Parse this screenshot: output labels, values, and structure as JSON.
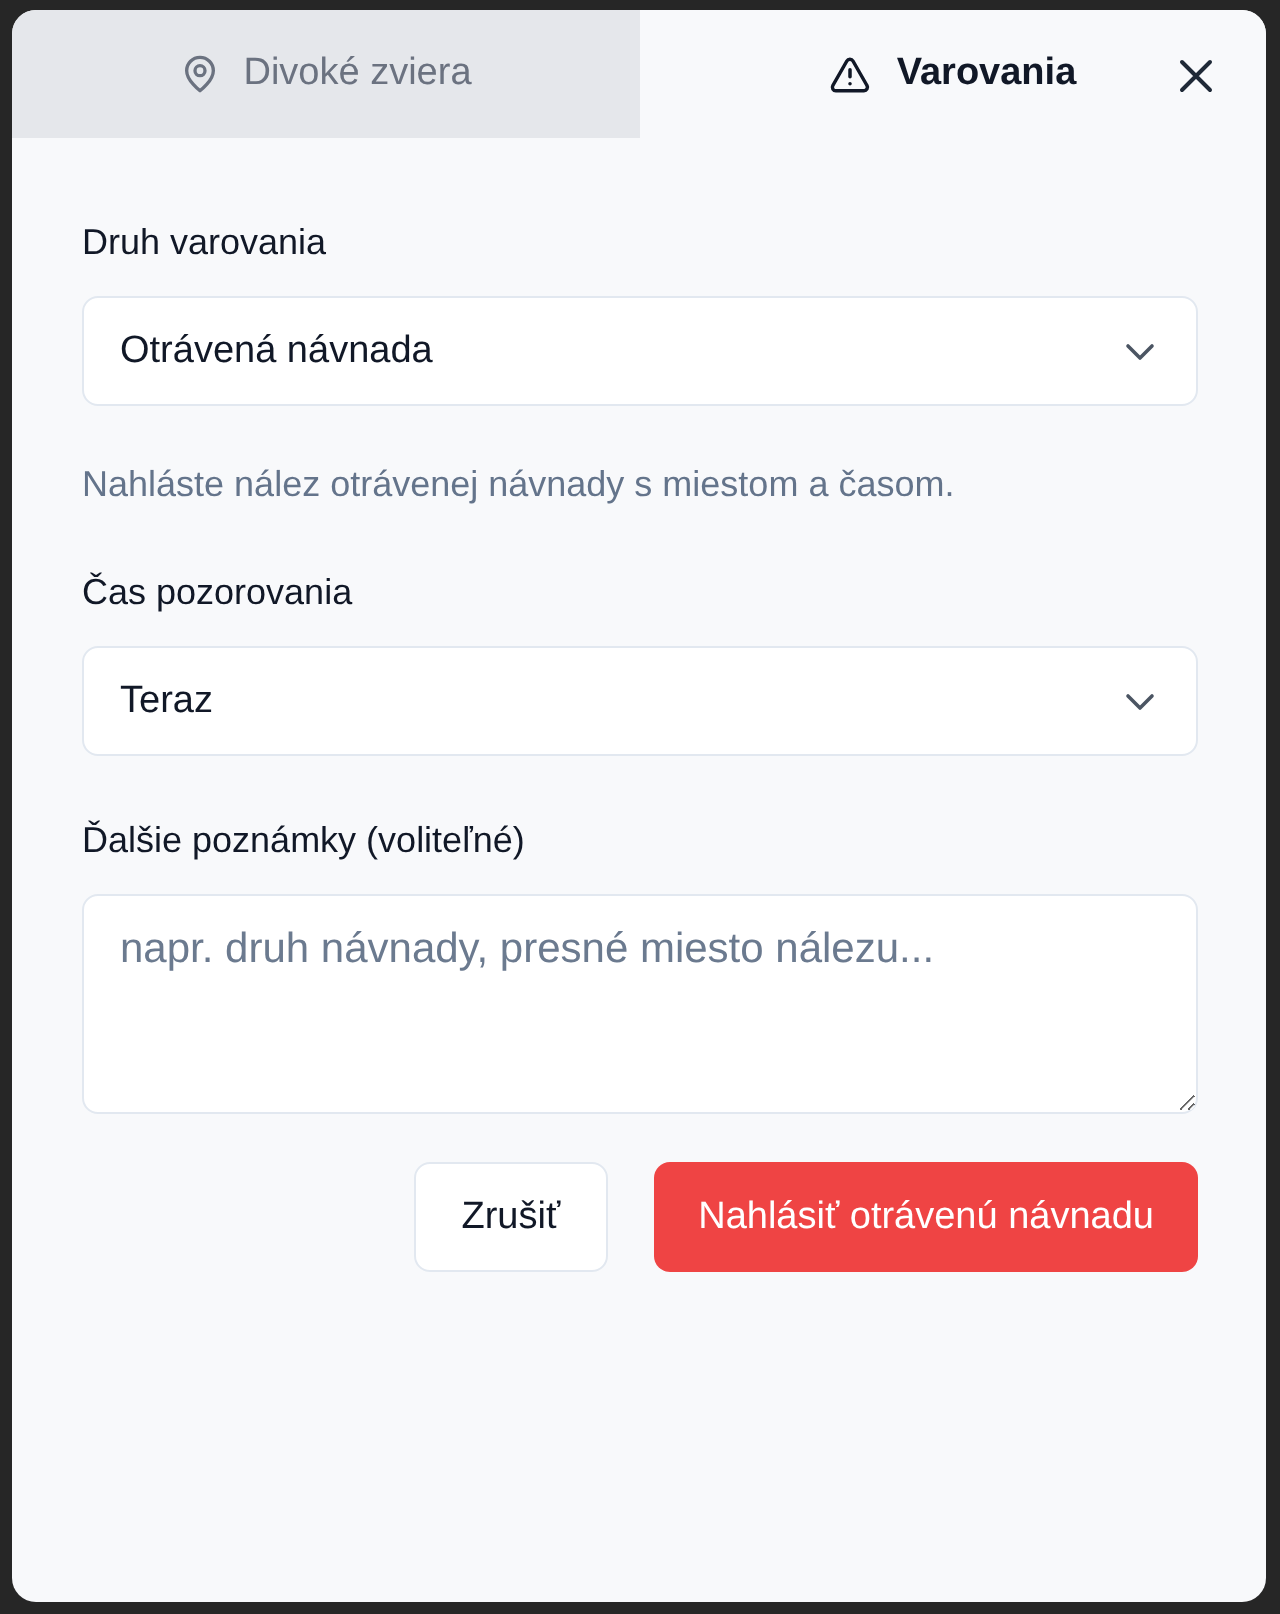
{
  "tabs": [
    {
      "label": "Divoké zviera",
      "selected": false
    },
    {
      "label": "Varovania",
      "selected": true
    }
  ],
  "fields": [
    {
      "kind": "select",
      "label": "Druh varovania",
      "value": "Otrávená návnada",
      "hint": "Nahláste nález otrávenej návnady s miestom a časom."
    },
    {
      "kind": "select",
      "label": "Čas pozorovania",
      "value": "Teraz"
    },
    {
      "kind": "textarea",
      "label": "Ďalšie poznámky (voliteľné)",
      "placeholder": "napr. druh návnady, presné miesto nálezu..."
    }
  ],
  "buttons": [
    {
      "label": "Zrušiť",
      "kind": "secondary"
    },
    {
      "label": "Nahlásiť otrávenú návnadu",
      "kind": "primary"
    }
  ]
}
